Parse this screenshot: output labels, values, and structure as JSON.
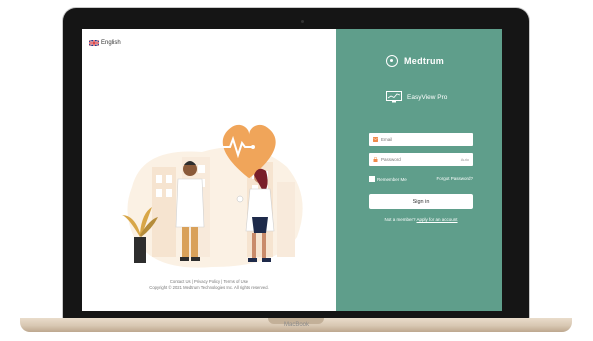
{
  "language": {
    "label": "English",
    "flag_icon": "uk-flag-icon"
  },
  "footer": {
    "contact": "Contact Us",
    "sep": "|",
    "privacy": "Privacy Policy",
    "terms": "Terms of Use",
    "copyright": "Copyright © 2021 Medtrum Technologies Inc. All rights reserved."
  },
  "brand": {
    "name": "Medtrum",
    "product": "EasyView Pro"
  },
  "login": {
    "email_placeholder": "Email",
    "password_placeholder": "Password",
    "password_suffix": "Auto",
    "remember_label": "Remember Me",
    "forgot_label": "Forgot Password?",
    "signin_label": "Sign in",
    "signup_prompt": "Not a member?",
    "signup_link": "Apply for an account"
  },
  "device": {
    "label": "MacBook"
  },
  "colors": {
    "accent": "#5f9e8b",
    "heart": "#f0a55a"
  }
}
